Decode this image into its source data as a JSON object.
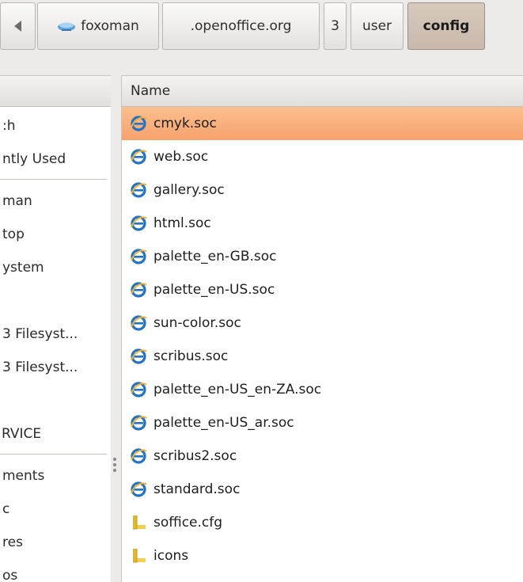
{
  "pathbar": {
    "buttons": [
      {
        "label": "",
        "icon": "left-arrow-icon"
      },
      {
        "label": "foxoman",
        "icon": "network-drive-icon"
      },
      {
        "label": ".openoffice.org"
      },
      {
        "label": "3"
      },
      {
        "label": "user"
      },
      {
        "label": "config",
        "active": true
      }
    ]
  },
  "sidebar": {
    "items": [
      {
        "label": ":h"
      },
      {
        "label": "ntly Used"
      },
      {
        "label": "man"
      },
      {
        "label": "top"
      },
      {
        "label": "ystem"
      },
      {
        "label": "3 Filesyst..."
      },
      {
        "label": "3 Filesyst..."
      },
      {
        "label": "RVICE"
      },
      {
        "label": "ments"
      },
      {
        "label": "c"
      },
      {
        "label": "res"
      },
      {
        "label": "os"
      }
    ]
  },
  "filelist": {
    "column_name": "Name",
    "files": [
      {
        "name": "cmyk.soc",
        "icon": "ie-file-icon",
        "selected": true
      },
      {
        "name": "web.soc",
        "icon": "ie-file-icon"
      },
      {
        "name": "gallery.soc",
        "icon": "ie-file-icon"
      },
      {
        "name": "html.soc",
        "icon": "ie-file-icon"
      },
      {
        "name": "palette_en-GB.soc",
        "icon": "ie-file-icon"
      },
      {
        "name": "palette_en-US.soc",
        "icon": "ie-file-icon"
      },
      {
        "name": "sun-color.soc",
        "icon": "ie-file-icon"
      },
      {
        "name": "scribus.soc",
        "icon": "ie-file-icon"
      },
      {
        "name": "palette_en-US_en-ZA.soc",
        "icon": "ie-file-icon"
      },
      {
        "name": "palette_en-US_ar.soc",
        "icon": "ie-file-icon"
      },
      {
        "name": "scribus2.soc",
        "icon": "ie-file-icon"
      },
      {
        "name": "standard.soc",
        "icon": "ie-file-icon"
      },
      {
        "name": "soffice.cfg",
        "icon": "folder-icon"
      },
      {
        "name": "icons",
        "icon": "folder-icon"
      }
    ]
  },
  "colors": {
    "selection": "#f7a26c",
    "active_crumb": "#c9b9ad",
    "ie_icon": "#1f74c7",
    "folder": "#e8c23a"
  }
}
